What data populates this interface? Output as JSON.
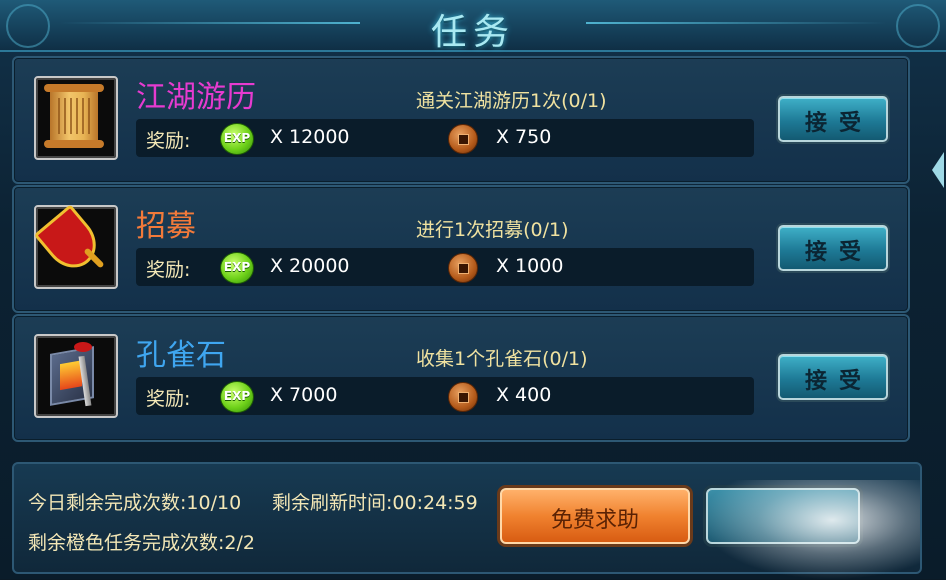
{
  "header": {
    "title": "任务"
  },
  "tasks": [
    {
      "name": "江湖游历",
      "name_color": "#e63bd0",
      "goal": "通关江湖游历1次(0/1)",
      "reward_label": "奖励:",
      "exp_text": "EXP",
      "exp_value": "X 12000",
      "coin_value": "X 750",
      "accept_label": "接受",
      "icon": "scroll-icon"
    },
    {
      "name": "招募",
      "name_color": "#f27a3a",
      "goal": "进行1次招募(0/1)",
      "reward_label": "奖励:",
      "exp_text": "EXP",
      "exp_value": "X 20000",
      "coin_value": "X 1000",
      "accept_label": "接受",
      "icon": "flag-icon"
    },
    {
      "name": "孔雀石",
      "name_color": "#3fa6f0",
      "goal": "收集1个孔雀石(0/1)",
      "reward_label": "奖励:",
      "exp_text": "EXP",
      "exp_value": "X 7000",
      "coin_value": "X 400",
      "accept_label": "接受",
      "icon": "malachite-icon"
    }
  ],
  "footer": {
    "today_remaining": "今日剩余完成次数:10/10",
    "refresh_time": "剩余刷新时间:00:24:59",
    "orange_remaining": "剩余橙色任务完成次数:2/2",
    "help_label": "免费求助"
  },
  "colors": {
    "accent": "#3fb0c8",
    "help_button": "#f0822f",
    "reward_text": "#f3e7b6",
    "goal_text": "#f0e2a0"
  }
}
